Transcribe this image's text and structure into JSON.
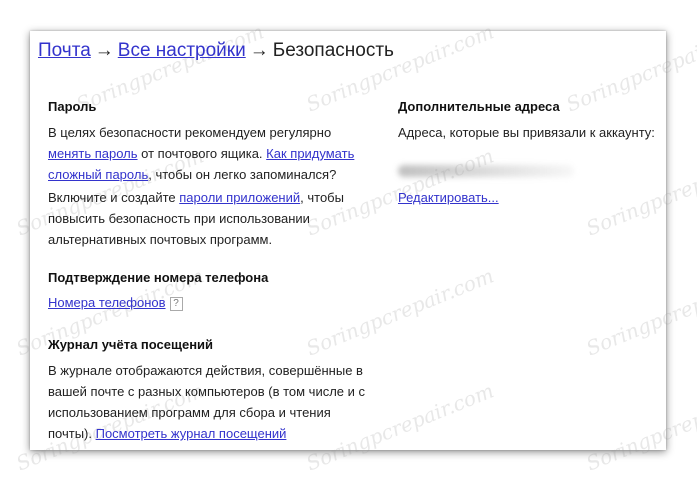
{
  "breadcrumb": {
    "mail": "Почта",
    "arrow": "→",
    "all_settings": "Все настройки",
    "current": "Безопасность"
  },
  "password": {
    "title": "Пароль",
    "line1": "В целях безопасности рекомендуем регулярно",
    "change_link": "менять пароль",
    "line2_mid": " от почтового ящика. ",
    "how_link_1": "Как придумать",
    "how_link_2": "сложный пароль",
    "line3_rest": ", чтобы он легко запоминался?",
    "line4_start": "Включите и создайте ",
    "app_passwords_link": "пароли приложений",
    "line4_end": ", чтобы",
    "line5": "повысить безопасность при использовании",
    "line6": "альтернативных почтовых программ."
  },
  "phone": {
    "title": "Подтверждение номера телефона",
    "numbers_link": "Номера телефонов",
    "help": "?"
  },
  "journal": {
    "title": "Журнал учёта посещений",
    "line1": "В журнале отображаются действия, совершённые в",
    "line2": "вашей почте с разных компьютеров (в том числе и с",
    "line3": "использованием программ для сбора и чтения",
    "line4_start": "почты). ",
    "view_link": "Посмотреть журнал посещений"
  },
  "extra": {
    "title": "Дополнительные адреса",
    "desc": "Адреса, которые вы привязали к аккаунту:",
    "edit_link": "Редактировать..."
  },
  "watermark": "Soringpcrepair.com"
}
